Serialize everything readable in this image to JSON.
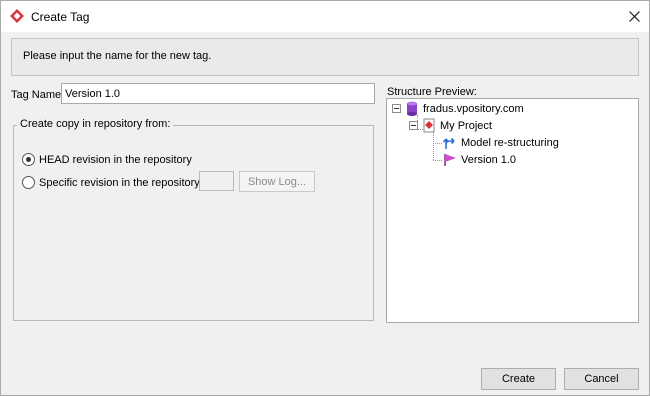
{
  "window": {
    "title": "Create Tag"
  },
  "banner": {
    "message": "Please input the name for the new tag."
  },
  "tag_name": {
    "label": "Tag Name:",
    "value": "Version 1.0"
  },
  "copy_group": {
    "legend": "Create copy in repository from:",
    "option_head": "HEAD revision in the repository",
    "option_specific": "Specific revision in the repository",
    "selected": "head",
    "show_log_label": "Show Log..."
  },
  "preview": {
    "label": "Structure Preview:",
    "server": "fradus.vpository.com",
    "project": "My Project",
    "branch": "Model re-structuring",
    "tag": "Version 1.0"
  },
  "buttons": {
    "create": "Create",
    "cancel": "Cancel"
  },
  "icons": {
    "app": "vp-diamond-icon",
    "close": "close-icon",
    "server": "database-cylinder-icon",
    "project": "project-icon",
    "branch": "branch-arrow-icon",
    "tag": "tag-flag-icon"
  },
  "colors": {
    "accent_red": "#d9323a",
    "server_purple": "#8b44c9",
    "branch_blue": "#2a6fd6",
    "tag_pink": "#d14ad1"
  }
}
